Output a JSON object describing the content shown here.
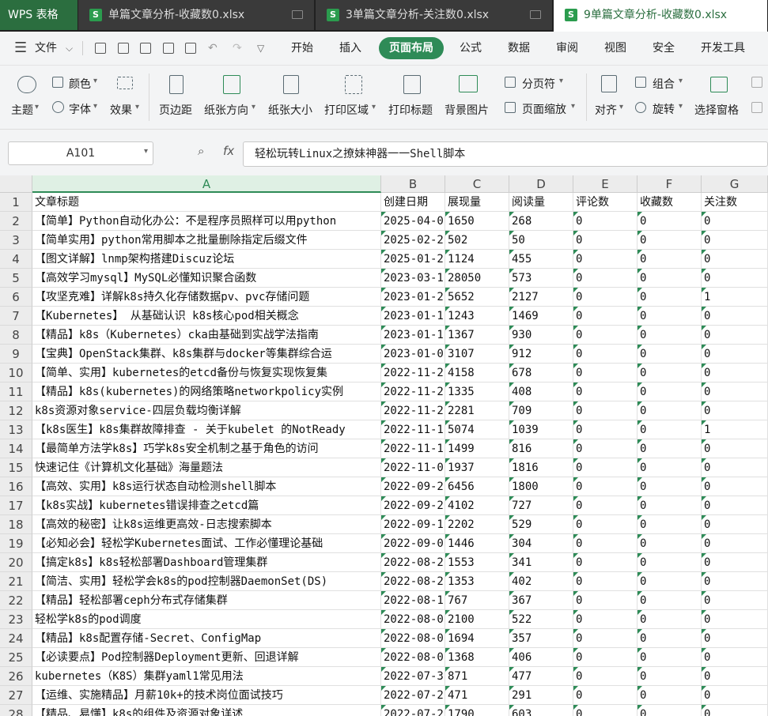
{
  "app": {
    "name": "WPS 表格"
  },
  "tabs": [
    {
      "label": "单篇文章分析-收藏数0.xlsx",
      "active": false
    },
    {
      "label": "3单篇文章分析-关注数0.xlsx",
      "active": false
    },
    {
      "label": "9单篇文章分析-收藏数0.xlsx",
      "active": true
    }
  ],
  "menu": {
    "file": "文件",
    "items": [
      "开始",
      "插入",
      "页面布局",
      "公式",
      "数据",
      "审阅",
      "视图",
      "安全",
      "开发工具"
    ],
    "active": "页面布局"
  },
  "ribbon": {
    "theme": "主题",
    "color": "颜色",
    "font": "字体",
    "effect": "效果",
    "margin": "页边距",
    "orientation": "纸张方向",
    "size": "纸张大小",
    "print_area": "打印区域",
    "print_titles": "打印标题",
    "background": "背景图片",
    "page_break": "分页符",
    "page_scale": "页面缩放",
    "align": "对齐",
    "group": "组合",
    "rotate": "旋转",
    "selection_pane": "选择窗格"
  },
  "formula_bar": {
    "name_box": "A101",
    "fx": "fx",
    "content": "轻松玩转Linux之撩妹神器一一Shell脚本"
  },
  "columns": [
    "A",
    "B",
    "C",
    "D",
    "E",
    "F",
    "G"
  ],
  "rows": [
    {
      "n": "1",
      "a": "文章标题",
      "b": "创建日期",
      "c": "展现量",
      "d": "阅读量",
      "e": "评论数",
      "f": "收藏数",
      "g": "关注数"
    },
    {
      "n": "2",
      "a": "【简单】Python自动化办公：不是程序员照样可以用python",
      "b": "2025-04-0",
      "c": "1650",
      "d": "268",
      "e": "0",
      "f": "0",
      "g": "0"
    },
    {
      "n": "3",
      "a": "【简单实用】python常用脚本之批量删除指定后缀文件",
      "b": "2025-02-2",
      "c": "502",
      "d": "50",
      "e": "0",
      "f": "0",
      "g": "0"
    },
    {
      "n": "4",
      "a": "【图文详解】lnmp架构搭建Discuz论坛",
      "b": "2025-01-2",
      "c": "1124",
      "d": "455",
      "e": "0",
      "f": "0",
      "g": "0"
    },
    {
      "n": "5",
      "a": "【高效学习mysql】MySQL必懂知识聚合函数",
      "b": "2023-03-1",
      "c": "28050",
      "d": "573",
      "e": "0",
      "f": "0",
      "g": "0"
    },
    {
      "n": "6",
      "a": "【攻坚克难】详解k8s持久化存储数据pv、pvc存储问题",
      "b": "2023-01-2",
      "c": "5652",
      "d": "2127",
      "e": "0",
      "f": "0",
      "g": "1"
    },
    {
      "n": "7",
      "a": "【Kubernetes】 从基础认识 k8s核心pod相关概念",
      "b": "2023-01-1",
      "c": "1243",
      "d": "1469",
      "e": "0",
      "f": "0",
      "g": "0"
    },
    {
      "n": "8",
      "a": "【精品】k8s（Kubernetes）cka由基础到实战学法指南",
      "b": "2023-01-1",
      "c": "1367",
      "d": "930",
      "e": "0",
      "f": "0",
      "g": "0"
    },
    {
      "n": "9",
      "a": "【宝典】OpenStack集群、k8s集群与docker等集群综合运",
      "b": "2023-01-0",
      "c": "3107",
      "d": "912",
      "e": "0",
      "f": "0",
      "g": "0"
    },
    {
      "n": "10",
      "a": "【简单、实用】kubernetes的etcd备份与恢复实现恢复集",
      "b": "2022-11-2",
      "c": "4158",
      "d": "678",
      "e": "0",
      "f": "0",
      "g": "0"
    },
    {
      "n": "11",
      "a": "【精品】k8s(kubernetes)的网络策略networkpolicy实例",
      "b": "2022-11-2",
      "c": "1335",
      "d": "408",
      "e": "0",
      "f": "0",
      "g": "0"
    },
    {
      "n": "12",
      "a": "k8s资源对象service-四层负载均衡详解",
      "b": "2022-11-2",
      "c": "2281",
      "d": "709",
      "e": "0",
      "f": "0",
      "g": "0"
    },
    {
      "n": "13",
      "a": "【k8s医生】k8s集群故障排查 - 关于kubelet 的NotReady",
      "b": "2022-11-1",
      "c": "5074",
      "d": "1039",
      "e": "0",
      "f": "0",
      "g": "1"
    },
    {
      "n": "14",
      "a": "【最简单方法学k8s】巧学k8s安全机制之基于角色的访问",
      "b": "2022-11-1",
      "c": "1499",
      "d": "816",
      "e": "0",
      "f": "0",
      "g": "0"
    },
    {
      "n": "15",
      "a": "快速记住《计算机文化基础》海量题法",
      "b": "2022-11-0",
      "c": "1937",
      "d": "1816",
      "e": "0",
      "f": "0",
      "g": "0"
    },
    {
      "n": "16",
      "a": "【高效、实用】k8s运行状态自动检测shell脚本",
      "b": "2022-09-2",
      "c": "6456",
      "d": "1800",
      "e": "0",
      "f": "0",
      "g": "0"
    },
    {
      "n": "17",
      "a": "【k8s实战】kubernetes错误排查之etcd篇",
      "b": "2022-09-2",
      "c": "4102",
      "d": "727",
      "e": "0",
      "f": "0",
      "g": "0"
    },
    {
      "n": "18",
      "a": "【高效的秘密】让k8s运维更高效-日志搜索脚本",
      "b": "2022-09-1",
      "c": "2202",
      "d": "529",
      "e": "0",
      "f": "0",
      "g": "0"
    },
    {
      "n": "19",
      "a": "【必知必会】轻松学Kubernetes面试、工作必懂理论基础",
      "b": "2022-09-0",
      "c": "1446",
      "d": "304",
      "e": "0",
      "f": "0",
      "g": "0"
    },
    {
      "n": "20",
      "a": "【搞定k8s】k8s轻松部署Dashboard管理集群",
      "b": "2022-08-2",
      "c": "1553",
      "d": "341",
      "e": "0",
      "f": "0",
      "g": "0"
    },
    {
      "n": "21",
      "a": "【简洁、实用】轻松学会k8s的pod控制器DaemonSet(DS)",
      "b": "2022-08-2",
      "c": "1353",
      "d": "402",
      "e": "0",
      "f": "0",
      "g": "0"
    },
    {
      "n": "22",
      "a": "【精品】轻松部署ceph分布式存储集群",
      "b": "2022-08-1",
      "c": "767",
      "d": "367",
      "e": "0",
      "f": "0",
      "g": "0"
    },
    {
      "n": "23",
      "a": "轻松学k8s的pod调度",
      "b": "2022-08-0",
      "c": "2100",
      "d": "522",
      "e": "0",
      "f": "0",
      "g": "0"
    },
    {
      "n": "24",
      "a": "【精品】k8s配置存储-Secret、ConfigMap",
      "b": "2022-08-0",
      "c": "1694",
      "d": "357",
      "e": "0",
      "f": "0",
      "g": "0"
    },
    {
      "n": "25",
      "a": "【必读要点】Pod控制器Deployment更新、回退详解",
      "b": "2022-08-0",
      "c": "1368",
      "d": "406",
      "e": "0",
      "f": "0",
      "g": "0"
    },
    {
      "n": "26",
      "a": "kubernetes（K8S）集群yaml1常见用法",
      "b": "2022-07-3",
      "c": "871",
      "d": "477",
      "e": "0",
      "f": "0",
      "g": "0"
    },
    {
      "n": "27",
      "a": "【运维、实施精品】月薪10k+的技术岗位面试技巧",
      "b": "2022-07-2",
      "c": "471",
      "d": "291",
      "e": "0",
      "f": "0",
      "g": "0"
    },
    {
      "n": "28",
      "a": "【精品、易懂】k8s的组件及资源对象详述",
      "b": "2022-07-2",
      "c": "1790",
      "d": "603",
      "e": "0",
      "f": "0",
      "g": "0"
    }
  ]
}
